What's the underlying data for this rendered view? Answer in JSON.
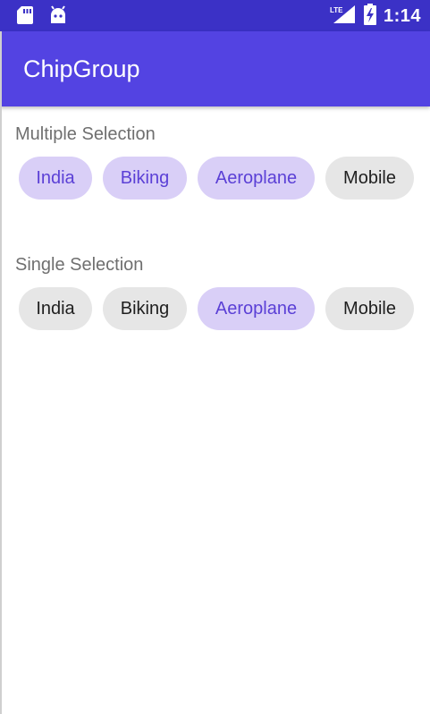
{
  "status_bar": {
    "time": "1:14",
    "network_label": "LTE",
    "icons": [
      "sd-card-icon",
      "android-icon",
      "lte-signal-icon",
      "battery-charging-icon"
    ]
  },
  "app_bar": {
    "title": "ChipGroup"
  },
  "colors": {
    "status_bar": "#3b31c6",
    "app_bar": "#5343e2",
    "chip_default": "#e6e6e6",
    "chip_selected": "#d9cff7",
    "chip_selected_text": "#5b40d6"
  },
  "multiple": {
    "label": "Multiple Selection",
    "chips": [
      {
        "label": "India",
        "selected": true
      },
      {
        "label": "Biking",
        "selected": true
      },
      {
        "label": "Aeroplane",
        "selected": true
      },
      {
        "label": "Mobile",
        "selected": false
      }
    ]
  },
  "single": {
    "label": "Single Selection",
    "chips": [
      {
        "label": "India",
        "selected": false
      },
      {
        "label": "Biking",
        "selected": false
      },
      {
        "label": "Aeroplane",
        "selected": true
      },
      {
        "label": "Mobile",
        "selected": false
      }
    ]
  }
}
